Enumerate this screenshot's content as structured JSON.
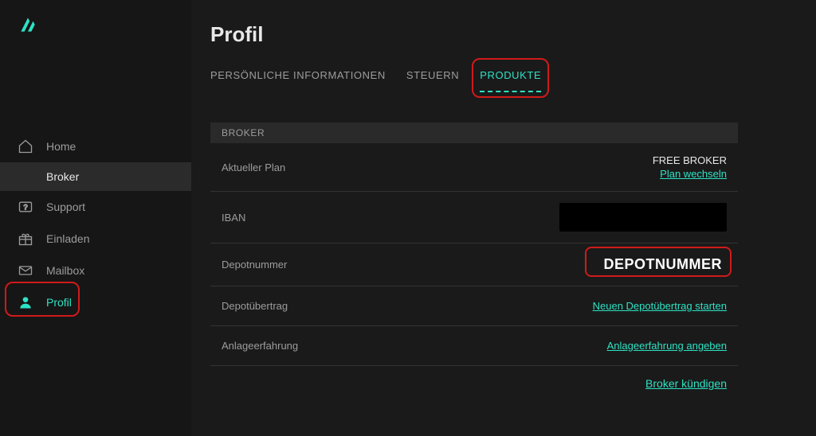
{
  "colors": {
    "accent": "#2de2c4",
    "red_highlight": "#d11a1a"
  },
  "sidebar": {
    "items": [
      {
        "id": "home",
        "label": "Home",
        "icon": "home-icon",
        "active": false,
        "selected": false
      },
      {
        "id": "broker",
        "label": "Broker",
        "icon": null,
        "active": false,
        "selected": true,
        "indent": true
      },
      {
        "id": "support",
        "label": "Support",
        "icon": "support-icon",
        "active": false,
        "selected": false
      },
      {
        "id": "invite",
        "label": "Einladen",
        "icon": "gift-icon",
        "active": false,
        "selected": false
      },
      {
        "id": "mailbox",
        "label": "Mailbox",
        "icon": "mail-icon",
        "active": false,
        "selected": false
      },
      {
        "id": "profil",
        "label": "Profil",
        "icon": "person-icon",
        "active": true,
        "selected": false,
        "highlighted": true
      }
    ]
  },
  "page": {
    "title": "Profil",
    "tabs": [
      {
        "id": "personal",
        "label": "PERSÖNLICHE INFORMATIONEN",
        "active": false
      },
      {
        "id": "tax",
        "label": "STEUERN",
        "active": false
      },
      {
        "id": "products",
        "label": "PRODUKTE",
        "active": true,
        "highlighted": true
      }
    ],
    "section": {
      "header": "BROKER",
      "rows": {
        "plan": {
          "label": "Aktueller Plan",
          "value": "FREE BROKER",
          "action": "Plan wechseln"
        },
        "iban": {
          "label": "IBAN",
          "value": ""
        },
        "depot": {
          "label": "Depotnummer",
          "value": "DEPOTNUMMER",
          "highlighted": true
        },
        "transfer": {
          "label": "Depotübertrag",
          "action": "Neuen Depotübertrag starten"
        },
        "experience": {
          "label": "Anlageerfahrung",
          "action": "Anlageerfahrung angeben"
        }
      },
      "footer_action": "Broker kündigen"
    }
  }
}
